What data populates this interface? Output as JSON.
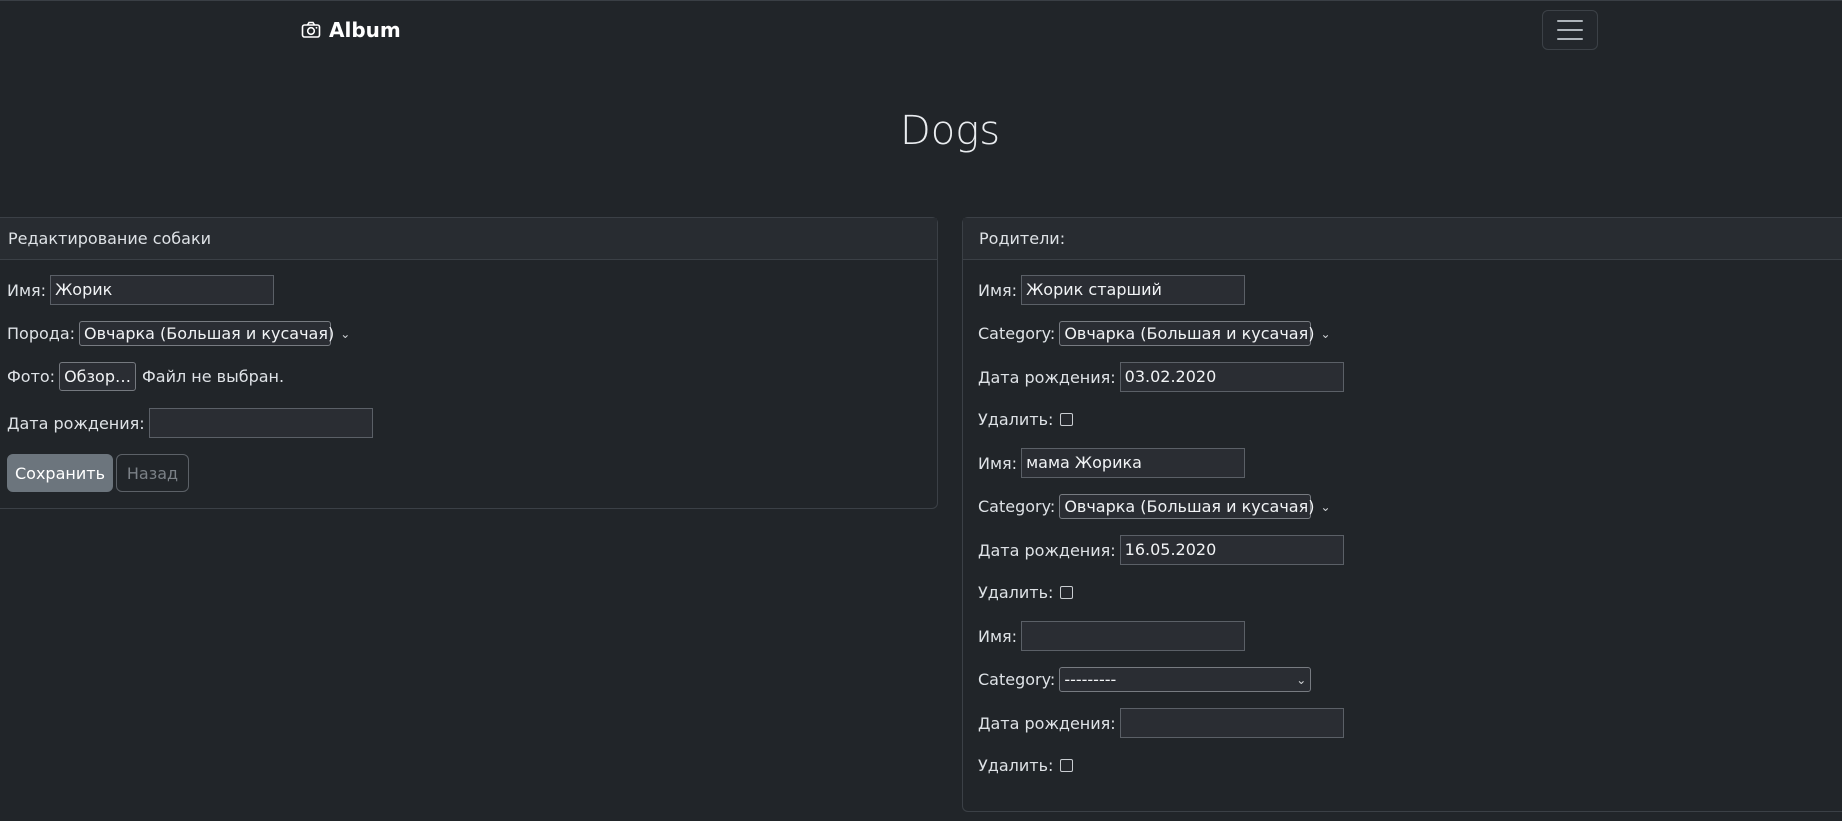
{
  "navbar": {
    "brand": "Album",
    "brand_icon": "camera-icon",
    "toggler_icon": "hamburger-menu-icon"
  },
  "page": {
    "title": "Dogs"
  },
  "edit_form": {
    "header": "Редактирование собаки",
    "name_label": "Имя:",
    "name_value": "Жорик",
    "breed_label": "Порода:",
    "breed_value": "Овчарка (Большая и кусачая)",
    "photo_label": "Фото:",
    "browse_label": "Обзор…",
    "file_status": "Файл не выбран.",
    "birthdate_label": "Дата рождения:",
    "birthdate_value": "",
    "save_label": "Сохранить",
    "back_label": "Назад"
  },
  "parents": {
    "header": "Родители:",
    "items": [
      {
        "name_label": "Имя:",
        "name_value": "Жорик старший",
        "category_label": "Category:",
        "category_value": "Овчарка (Большая и кусачая)",
        "birthdate_label": "Дата рождения:",
        "birthdate_value": "03.02.2020",
        "delete_label": "Удалить:"
      },
      {
        "name_label": "Имя:",
        "name_value": "мама Жорика",
        "category_label": "Category:",
        "category_value": "Овчарка (Большая и кусачая)",
        "birthdate_label": "Дата рождения:",
        "birthdate_value": "16.05.2020",
        "delete_label": "Удалить:"
      },
      {
        "name_label": "Имя:",
        "name_value": "",
        "category_label": "Category:",
        "category_value": "---------",
        "birthdate_label": "Дата рождения:",
        "birthdate_value": "",
        "delete_label": "Удалить:"
      }
    ]
  }
}
